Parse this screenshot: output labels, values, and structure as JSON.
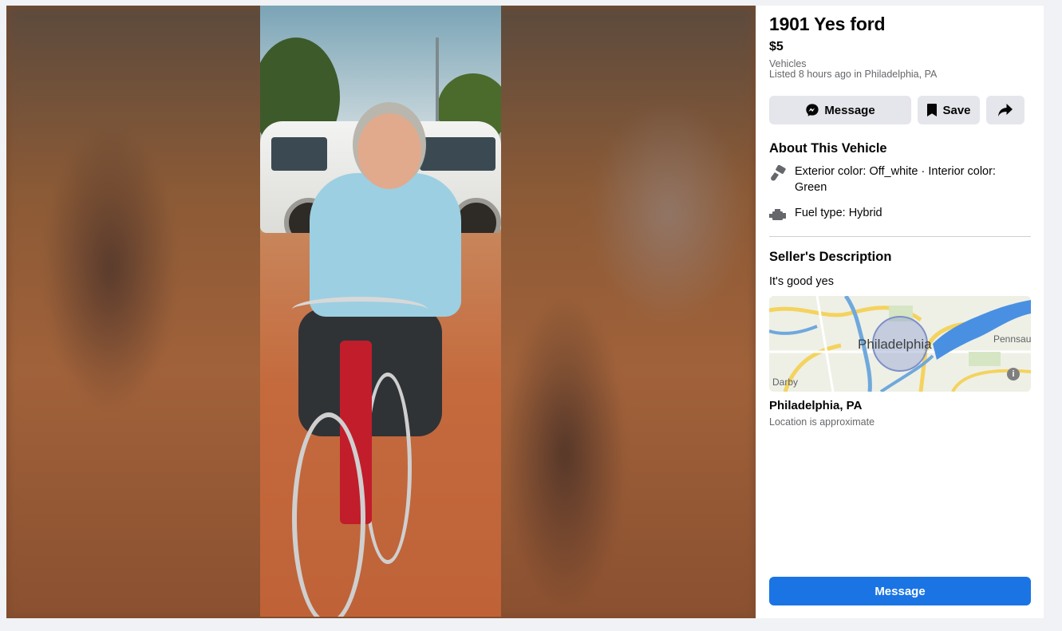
{
  "listing": {
    "title": "1901 Yes ford",
    "price": "$5",
    "category": "Vehicles",
    "listed": "Listed 8 hours ago in Philadelphia, PA"
  },
  "actions": {
    "message_label": "Message",
    "save_label": "Save",
    "share_icon": "share-arrow-icon",
    "message_icon": "messenger-icon",
    "save_icon": "bookmark-icon"
  },
  "about": {
    "heading": "About This Vehicle",
    "details": [
      {
        "icon": "paint-brush-icon",
        "text": "Exterior color: Off_white · Interior color: Green"
      },
      {
        "icon": "engine-icon",
        "text": "Fuel type: Hybrid"
      }
    ]
  },
  "seller": {
    "heading": "Seller's Description",
    "description": "It's good yes"
  },
  "map": {
    "city_label": "Philadelphia",
    "east_label": "Pennsau",
    "west_label": "Darby",
    "info_icon": "info-icon"
  },
  "location": {
    "name": "Philadelphia, PA",
    "note": "Location is approximate"
  },
  "primary_button": {
    "label": "Message"
  },
  "colors": {
    "accent": "#1b74e4",
    "secondary_button": "#e4e6eb",
    "muted_text": "#65676b",
    "page_bg": "#f0f2f5"
  }
}
